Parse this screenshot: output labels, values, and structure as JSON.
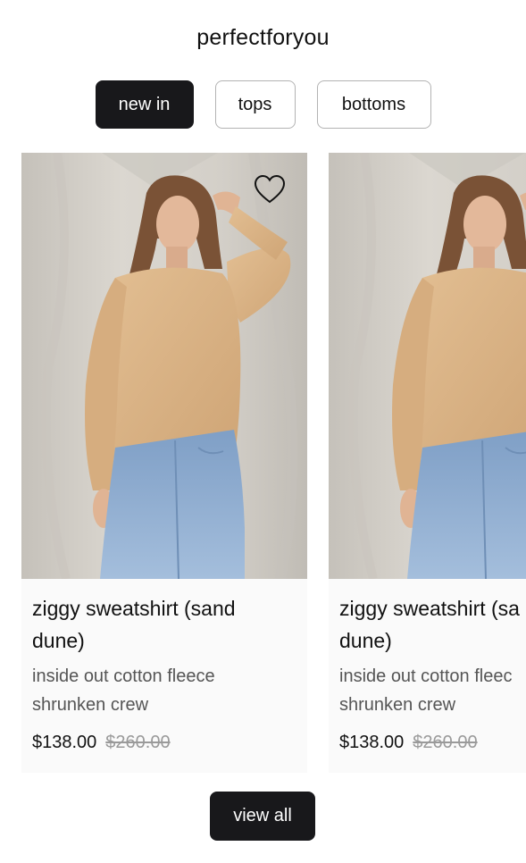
{
  "brand": {
    "name": "perfectforyou"
  },
  "tabs": [
    {
      "label": "new in",
      "active": true
    },
    {
      "label": "tops",
      "active": false
    },
    {
      "label": "bottoms",
      "active": false
    }
  ],
  "products": [
    {
      "name_line1": "ziggy sweatshirt (sand",
      "name_line2": "dune)",
      "desc_line1": "inside out cotton fleece",
      "desc_line2": "shrunken crew",
      "price": "$138.00",
      "compare_price": "$260.00",
      "image": "model-in-sand-sweatshirt-and-jeans",
      "favorite_icon": "heart-outline-icon"
    },
    {
      "name_line1": "ziggy sweatshirt (sa",
      "name_line2": "dune)",
      "desc_line1": "inside out cotton fleec",
      "desc_line2": "shrunken crew",
      "price": "$138.00",
      "compare_price": "$260.00",
      "image": "model-in-sand-sweatshirt-and-jeans"
    }
  ],
  "view_all": {
    "label": "view all"
  },
  "colors": {
    "active_tab_bg": "#18181b",
    "sweater": "#dcb68a",
    "denim": "#8eaed3",
    "muted_text": "#555555",
    "strike_price": "#9a9a9a"
  }
}
